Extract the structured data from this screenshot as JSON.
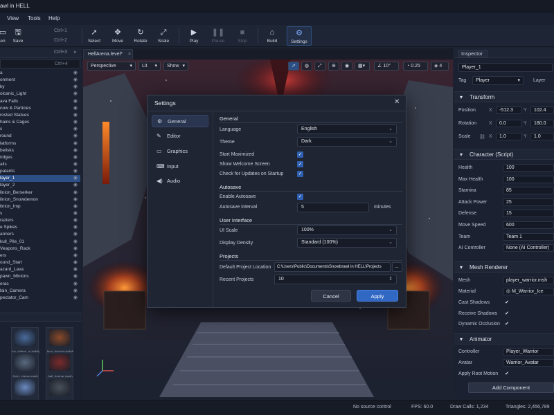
{
  "window": {
    "title": "awl in HELL"
  },
  "menu": [
    "View",
    "Tools",
    "Help"
  ],
  "toolbar": {
    "items": [
      {
        "label": "en",
        "icon": "open-folder-icon"
      },
      {
        "label": "Save",
        "icon": "save-icon"
      },
      {
        "label": "Select",
        "icon": "cursor-icon"
      },
      {
        "label": "Move",
        "icon": "move-icon"
      },
      {
        "label": "Rotate",
        "icon": "rotate-icon"
      },
      {
        "label": "Scale",
        "icon": "scale-icon"
      },
      {
        "label": "Play",
        "icon": "play-icon"
      },
      {
        "label": "Pause",
        "icon": "pause-icon"
      },
      {
        "label": "Stop",
        "icon": "stop-icon"
      },
      {
        "label": "Build",
        "icon": "build-icon"
      },
      {
        "label": "Settings",
        "icon": "gear-icon"
      }
    ],
    "shortcuts": [
      "Ctrl+1",
      "Ctrl+2"
    ]
  },
  "hierarchy": {
    "header_shortcut": "Ctrl+3",
    "search_shortcut": "Ctrl+4",
    "items": [
      "a",
      "onment",
      "ky",
      "olcanic_Light",
      "ava Falls",
      "now & Particles",
      "rosted Statues",
      "hains & Cages",
      "s",
      "round",
      "latforms",
      "belisks",
      "ridges",
      "ails",
      "patants",
      "layer_1",
      "layer_2",
      "linion_Berserker",
      "linion_Snowdemon",
      "linion_Imp",
      "s",
      "raziers",
      "e Spikes",
      "anners",
      "kull_Pile_01",
      "Veapons_Rack",
      "ers",
      "ound_Start",
      "azard_Lava",
      "pawn_Minions",
      "eras",
      "lain_Camera",
      "pectator_Cam"
    ],
    "selected_index": 15
  },
  "assets": [
    {
      "name": "ice_spikes_a.prefab",
      "color": "#4a6a9a"
    },
    {
      "name": "lava_brazier.prefab",
      "color": "#8a4a2a"
    },
    {
      "name": "frost_statue.mesh",
      "color": "#5a6a80"
    },
    {
      "name": "hell_banner.mesh",
      "color": "#7a2a2a"
    },
    {
      "name": "snow_particle.pfx",
      "color": "#6a8ac0"
    },
    {
      "name": "chains_set.mesh",
      "color": "#4a505a"
    }
  ],
  "viewport": {
    "tab": "HellArena.level*",
    "close": "×",
    "view_mode": "Perspective",
    "shading": "Lit",
    "show": "Show",
    "snap_angle": "10°",
    "snap_scale": "0.25",
    "layers": "4"
  },
  "inspector": {
    "title": "Inspector",
    "object_name": "Player_1",
    "tag_label": "Tag",
    "tag_value": "Player",
    "layer_label": "Layer",
    "transform": {
      "title": "Transform",
      "position_label": "Position",
      "px": "-512.3",
      "py": "102.4",
      "rotation_label": "Rotation",
      "rx": "0.0",
      "ry": "180.0",
      "scale_label": "Scale",
      "sx": "1.0",
      "sy": "1.0"
    },
    "character": {
      "title": "Character (Script)",
      "rows": [
        {
          "label": "Health",
          "value": "100"
        },
        {
          "label": "Max Health",
          "value": "100"
        },
        {
          "label": "Stamina",
          "value": "85"
        },
        {
          "label": "Attack Power",
          "value": "25"
        },
        {
          "label": "Defense",
          "value": "15"
        },
        {
          "label": "Move Speed",
          "value": "600"
        },
        {
          "label": "Team",
          "value": "Team 1"
        },
        {
          "label": "AI Controller",
          "value": "None (AI Controller)"
        }
      ]
    },
    "mesh": {
      "title": "Mesh Renderer",
      "mesh_label": "Mesh",
      "mesh_value": "player_warrior.msh",
      "material_label": "Material",
      "material_value": "M_Warrior_Ice",
      "cast_label": "Cast Shadows",
      "receive_label": "Receive Shadows",
      "dyn_label": "Dynamic Occlusion"
    },
    "animator": {
      "title": "Animator",
      "controller_label": "Controller",
      "controller_value": "Player_Warrior",
      "avatar_label": "Avatar",
      "avatar_value": "Warrior_Avatar",
      "root_label": "Apply Root Motion"
    },
    "add_component": "Add Component"
  },
  "status": {
    "source": "No source control",
    "fps": "FPS: 60.0",
    "draw_calls": "Draw Calls: 1,234",
    "triangles": "Triangles: 2,456,789"
  },
  "settings": {
    "title": "Settings",
    "nav": [
      "General",
      "Editor",
      "Graphics",
      "Input",
      "Audio"
    ],
    "general": {
      "heading": "General",
      "language_label": "Language",
      "language": "English",
      "theme_label": "Theme",
      "theme": "Dark",
      "start_max": "Start Maximized",
      "welcome": "Show Welcome Screen",
      "updates": "Check for Updates on Startup"
    },
    "autosave": {
      "heading": "Autosave",
      "enable": "Enable Autosave",
      "interval_label": "Autosave Interval",
      "interval": "5",
      "unit": "minutes"
    },
    "ui": {
      "heading": "User Interface",
      "scale_label": "UI Scale",
      "scale": "100%",
      "density_label": "Display Density",
      "density": "Standard (100%)"
    },
    "projects": {
      "heading": "Projects",
      "location_label": "Default Project Location",
      "location": "C:\\Users\\Public\\Documents\\Snowbrawl in HELL\\Projects",
      "browse": "...",
      "recent_label": "Recent Projects",
      "recent": "10"
    },
    "cancel": "Cancel",
    "apply": "Apply"
  }
}
